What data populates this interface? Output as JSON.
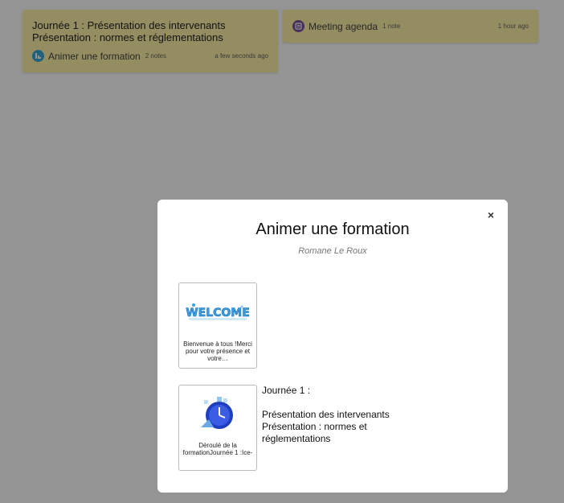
{
  "board_cards": [
    {
      "note": "Journée 1 : Présentation des intervenants\nPrésentation : normes et réglementations",
      "board_title": "Animer une formation",
      "note_count": "2 notes",
      "time": "a few seconds ago",
      "icon": "board-icon-blue",
      "icon_color": "#3aa7d6"
    },
    {
      "board_title": "Meeting agenda",
      "note_count": "1 note",
      "time": "1 hour ago",
      "icon": "board-icon-purple",
      "icon_color": "#7a4f9e"
    }
  ],
  "card_color": "#fff3a8",
  "modal": {
    "close_label": "×",
    "title": "Animer une formation",
    "author": "Romane Le Roux",
    "items": [
      {
        "thumb_text": "WELCOME",
        "caption": "Bienvenue à tous !Merci pour votre présence et votre…"
      },
      {
        "thumb_icon": "clock-icon",
        "caption": "Déroulé de la formationJournée 1 :Ice-"
      }
    ],
    "note_text": "Journée 1 :\n\nPrésentation des intervenants\nPrésentation : normes et réglementations"
  }
}
